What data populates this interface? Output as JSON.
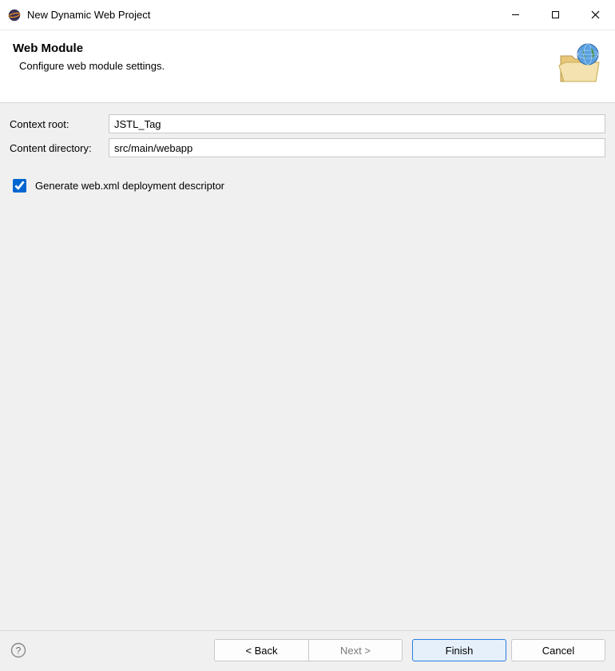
{
  "window": {
    "title": "New Dynamic Web Project"
  },
  "header": {
    "title": "Web Module",
    "subtitle": "Configure web module settings."
  },
  "form": {
    "context_root": {
      "label": "Context root:",
      "value": "JSTL_Tag"
    },
    "content_directory": {
      "label": "Content directory:",
      "value": "src/main/webapp"
    },
    "generate_webxml": {
      "label": "Generate web.xml deployment descriptor",
      "checked": true
    }
  },
  "footer": {
    "back": "< Back",
    "next": "Next >",
    "finish": "Finish",
    "cancel": "Cancel"
  }
}
